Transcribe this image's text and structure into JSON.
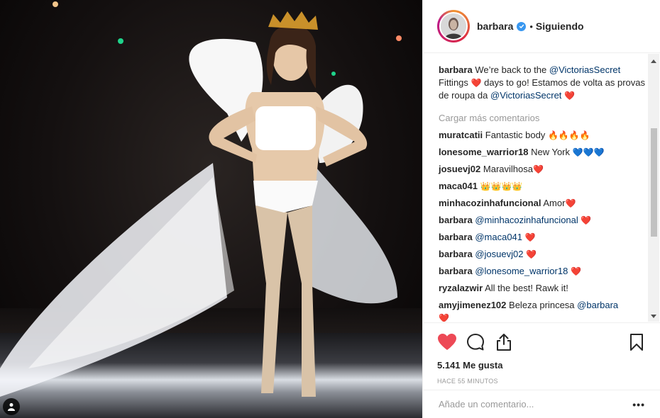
{
  "header": {
    "username": "barbara",
    "separator": "•",
    "follow_label": "Siguiendo"
  },
  "caption": {
    "user": "barbara",
    "text1": "We’re back to the",
    "mention1": "@VictoriasSecret",
    "text2": "Fittings",
    "text3": "days to go! Estamos de volta as provas de roupa da",
    "mention2": "@VictoriasSecret"
  },
  "load_more": "Cargar más comentarios",
  "comments": [
    {
      "user": "muratcatii",
      "text": "Fantastic body",
      "emoji": "🔥🔥🔥🔥"
    },
    {
      "user": "lonesome_warrior18",
      "text": "New York",
      "emoji": "💙💙💙"
    },
    {
      "user": "josuevj02",
      "text": "Maravilhosa",
      "emoji": "❤️"
    },
    {
      "user": "maca041",
      "text": "",
      "emoji": "👑👑👑👑"
    },
    {
      "user": "minhacozinhafuncional",
      "text": "Amor",
      "emoji": "❤️"
    },
    {
      "user": "barbara",
      "mention": "@minhacozinhafuncional",
      "emoji": "❤️"
    },
    {
      "user": "barbara",
      "mention": "@maca041",
      "emoji": "❤️"
    },
    {
      "user": "barbara",
      "mention": "@josuevj02",
      "emoji": "❤️"
    },
    {
      "user": "barbara",
      "mention": "@lonesome_warrior18",
      "emoji": "❤️"
    },
    {
      "user": "ryzalazwir",
      "text": "All the best! Rawk it!",
      "emoji": ""
    },
    {
      "user": "amyjimenez102",
      "text": "Beleza princesa",
      "mention": "@barbara",
      "emoji": "❤️"
    }
  ],
  "likes": "5.141 Me gusta",
  "timestamp": "HACE 55 MINUTOS",
  "add_comment": {
    "placeholder": "Añade un comentario..."
  },
  "more_options": "•••",
  "colors": {
    "heart": "#ed4956",
    "link": "#003569",
    "verified": "#3897f0",
    "muted": "#999999"
  },
  "icons": [
    "user-tag-icon",
    "verified-icon",
    "heart-icon",
    "comment-icon",
    "share-icon",
    "bookmark-icon",
    "ellipsis-icon"
  ]
}
